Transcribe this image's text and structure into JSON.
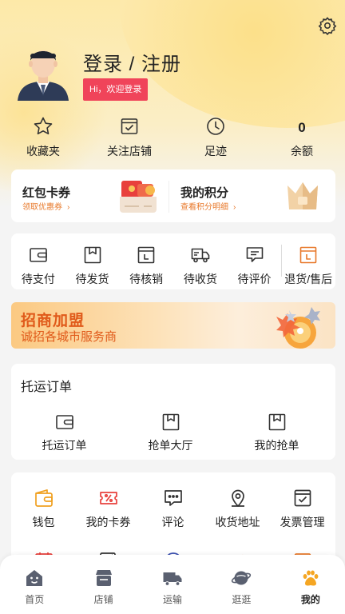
{
  "header": {
    "login_title": "登录 / 注册",
    "welcome": "Hi，欢迎登录",
    "settings_icon": "gear-icon"
  },
  "stats": [
    {
      "icon": "star-icon",
      "label": "收藏夹"
    },
    {
      "icon": "store-check-icon",
      "label": "关注店铺"
    },
    {
      "icon": "clock-icon",
      "label": "足迹"
    },
    {
      "value": "0",
      "label": "余额"
    }
  ],
  "promo": {
    "left": {
      "title": "红包卡券",
      "sub": "领取优惠券"
    },
    "right": {
      "title": "我的积分",
      "sub": "查看积分明细"
    }
  },
  "orders": [
    {
      "icon": "wallet-icon",
      "label": "待支付"
    },
    {
      "icon": "box-icon",
      "label": "待发货"
    },
    {
      "icon": "verify-icon",
      "label": "待核销"
    },
    {
      "icon": "truck-icon",
      "label": "待收货"
    },
    {
      "icon": "comment-icon",
      "label": "待评价"
    },
    {
      "icon": "refund-icon",
      "label": "退货/售后"
    }
  ],
  "banner": {
    "title": "招商加盟",
    "sub": "诚招各城市服务商"
  },
  "shipping": {
    "title": "托运订单",
    "items": [
      {
        "icon": "wallet-icon",
        "label": "托运订单"
      },
      {
        "icon": "box-icon",
        "label": "抢单大厅"
      },
      {
        "icon": "box-icon",
        "label": "我的抢单"
      }
    ]
  },
  "tools": [
    {
      "icon": "wallet-icon",
      "label": "钱包"
    },
    {
      "icon": "coupon-icon",
      "label": "我的卡券"
    },
    {
      "icon": "comment-icon",
      "label": "评论"
    },
    {
      "icon": "location-icon",
      "label": "收货地址"
    },
    {
      "icon": "invoice-icon",
      "label": "发票管理"
    }
  ],
  "tabs": [
    {
      "icon": "home-icon",
      "label": "首页"
    },
    {
      "icon": "shop-icon",
      "label": "店铺"
    },
    {
      "icon": "truck-icon",
      "label": "运输"
    },
    {
      "icon": "planet-icon",
      "label": "逛逛"
    },
    {
      "icon": "paw-icon",
      "label": "我的",
      "active": true
    }
  ],
  "colors": {
    "accent": "#f0445a",
    "orange": "#e8792b",
    "active_tab": "#f5a623"
  }
}
